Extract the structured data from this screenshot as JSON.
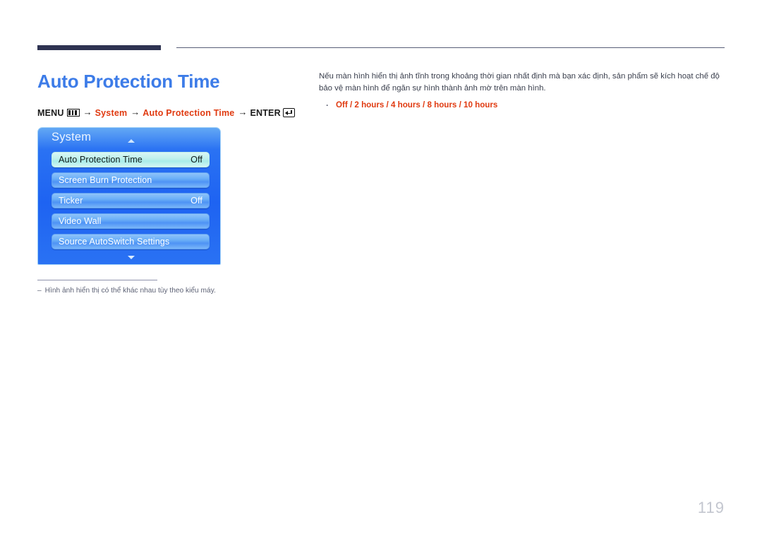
{
  "document": {
    "page_number": "119"
  },
  "header": {
    "title": "Auto Protection Time"
  },
  "breadcrumb": {
    "menu_label": "MENU",
    "menu_icon": "menu-bars-icon",
    "arrow": "→",
    "step_system": "System",
    "step_feature": "Auto Protection Time",
    "enter_label": "ENTER",
    "enter_icon": "enter-return-icon"
  },
  "osd": {
    "title": "System",
    "scroll_up_icon": "caret-up-icon",
    "scroll_down_icon": "caret-down-icon",
    "rows": [
      {
        "label": "Auto Protection Time",
        "value": "Off",
        "selected": true
      },
      {
        "label": "Screen Burn Protection",
        "value": "",
        "selected": false
      },
      {
        "label": "Ticker",
        "value": "Off",
        "selected": false
      },
      {
        "label": "Video Wall",
        "value": "",
        "selected": false
      },
      {
        "label": "Source AutoSwitch Settings",
        "value": "",
        "selected": false
      }
    ]
  },
  "footnote": {
    "dash": "–",
    "text": "Hình ảnh hiển thị có thể khác nhau tùy theo kiểu máy."
  },
  "description": {
    "paragraph": "Nếu màn hình hiển thị ảnh tĩnh trong khoảng thời gian nhất định mà bạn xác định, sản phẩm sẽ kích hoạt chế độ bảo vệ màn hình để ngăn sự hình thành ảnh mờ trên màn hình.",
    "bullet_marker": "·",
    "options": "Off / 2 hours / 4 hours / 8 hours / 10 hours"
  },
  "colors": {
    "title_blue": "#3d7ce8",
    "accent_red": "#e03a10",
    "rule_navy": "#2e3352",
    "osd_blue": "#1e63f2",
    "osd_selected": "#bdf0ec",
    "page_number_gray": "#c3c6cf"
  }
}
